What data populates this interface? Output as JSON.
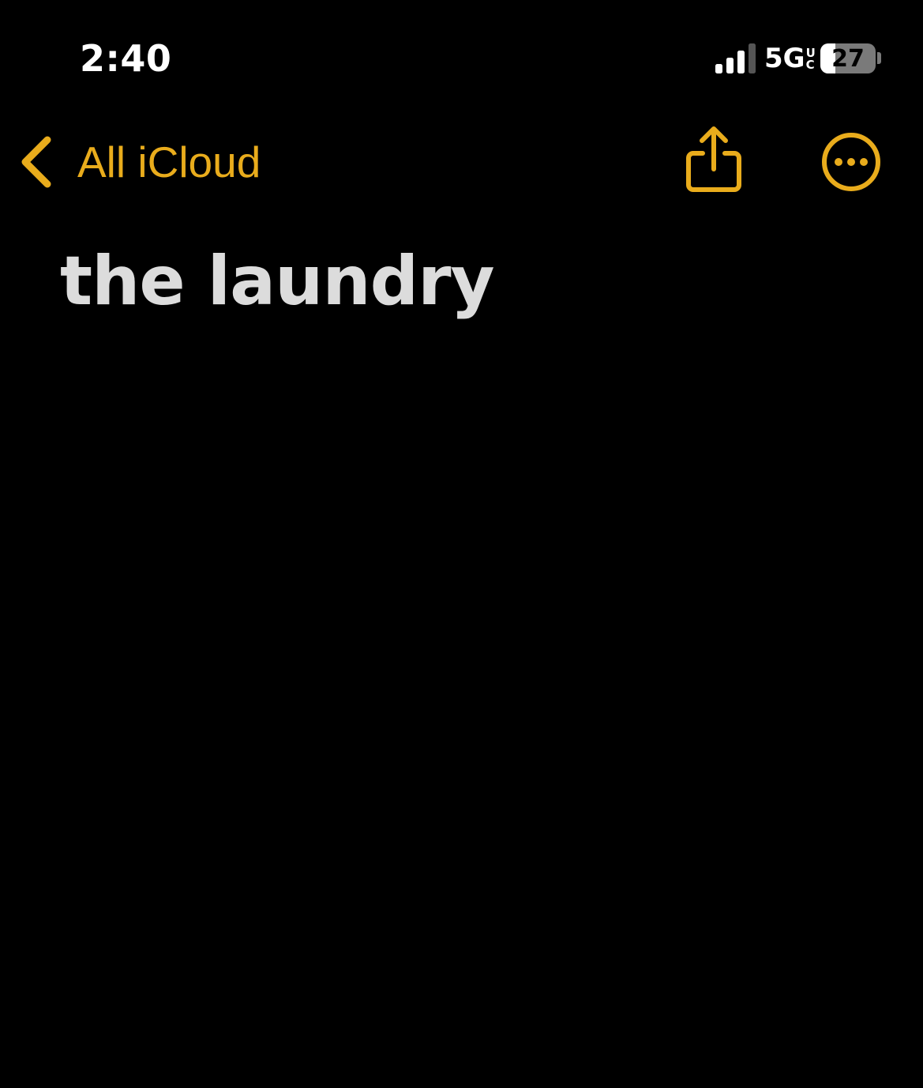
{
  "status_bar": {
    "time": "2:40",
    "network": "5G",
    "network_sub_top": "U",
    "network_sub_bottom": "C",
    "battery_level": "27",
    "battery_fraction": 0.27,
    "signal_bars_active": 3,
    "signal_bars_total": 4
  },
  "nav": {
    "back_label": "All iCloud",
    "back_icon": "chevron-left-icon",
    "share_icon": "share-icon",
    "more_icon": "ellipsis-circle-icon"
  },
  "note": {
    "title": "the laundry"
  },
  "colors": {
    "background": "#000000",
    "accent": "#e9ac1c",
    "title_text": "#dcdcdc",
    "status_text": "#ffffff"
  }
}
